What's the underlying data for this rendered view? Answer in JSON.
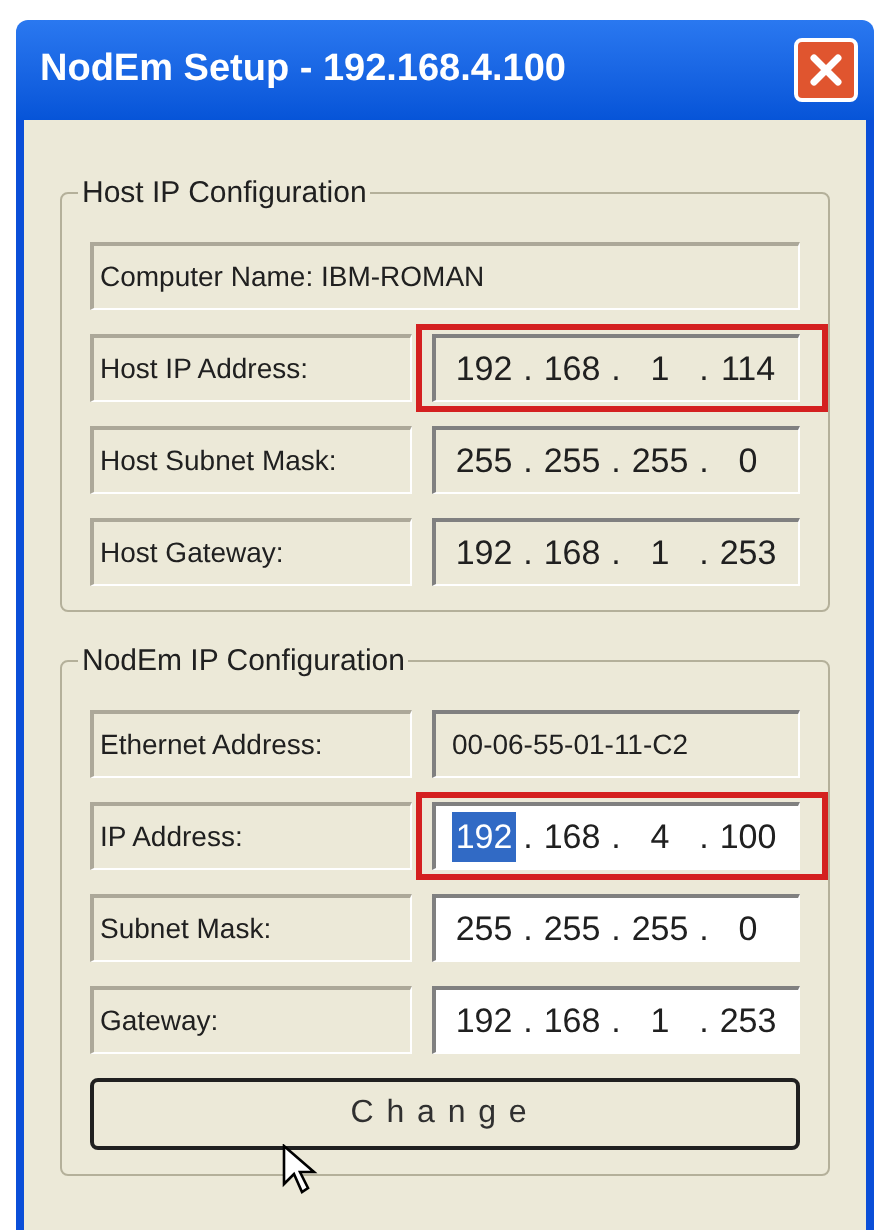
{
  "window": {
    "title": "NodEm Setup - 192.168.4.100"
  },
  "groups": [
    {
      "title": "Host IP Configuration",
      "rows": [
        {
          "kind": "static",
          "label": "Computer Name: IBM-ROMAN"
        },
        {
          "kind": "ip",
          "label": "Host IP Address:",
          "separator": ".",
          "editable": false,
          "highlighted": true,
          "octets": [
            {
              "text": "192",
              "selected": false
            },
            {
              "text": "168",
              "selected": false
            },
            {
              "text": "1",
              "selected": false
            },
            {
              "text": "114",
              "selected": false
            }
          ]
        },
        {
          "kind": "ip",
          "label": "Host Subnet Mask:",
          "separator": ".",
          "editable": false,
          "highlighted": false,
          "octets": [
            {
              "text": "255",
              "selected": false
            },
            {
              "text": "255",
              "selected": false
            },
            {
              "text": "255",
              "selected": false
            },
            {
              "text": "0",
              "selected": false
            }
          ]
        },
        {
          "kind": "ip",
          "label": "Host Gateway:",
          "separator": ".",
          "editable": false,
          "highlighted": false,
          "octets": [
            {
              "text": "192",
              "selected": false
            },
            {
              "text": "168",
              "selected": false
            },
            {
              "text": "1",
              "selected": false
            },
            {
              "text": "253",
              "selected": false
            }
          ]
        }
      ]
    },
    {
      "title": "NodEm IP Configuration",
      "rows": [
        {
          "kind": "text",
          "label": "Ethernet Address:",
          "editable": false,
          "highlighted": false,
          "value": "00-06-55-01-11-C2"
        },
        {
          "kind": "ip",
          "label": "IP Address:",
          "separator": ".",
          "editable": true,
          "highlighted": true,
          "octets": [
            {
              "text": "192",
              "selected": true
            },
            {
              "text": "168",
              "selected": false
            },
            {
              "text": "4",
              "selected": false
            },
            {
              "text": "100",
              "selected": false
            }
          ]
        },
        {
          "kind": "ip",
          "label": "Subnet Mask:",
          "separator": ".",
          "editable": true,
          "highlighted": false,
          "octets": [
            {
              "text": "255",
              "selected": false
            },
            {
              "text": "255",
              "selected": false
            },
            {
              "text": "255",
              "selected": false
            },
            {
              "text": "0",
              "selected": false
            }
          ]
        },
        {
          "kind": "ip",
          "label": "Gateway:",
          "separator": ".",
          "editable": true,
          "highlighted": false,
          "octets": [
            {
              "text": "192",
              "selected": false
            },
            {
              "text": "168",
              "selected": false
            },
            {
              "text": "1",
              "selected": false
            },
            {
              "text": "253",
              "selected": false
            }
          ]
        }
      ]
    }
  ],
  "change_button": {
    "label": "Change"
  }
}
